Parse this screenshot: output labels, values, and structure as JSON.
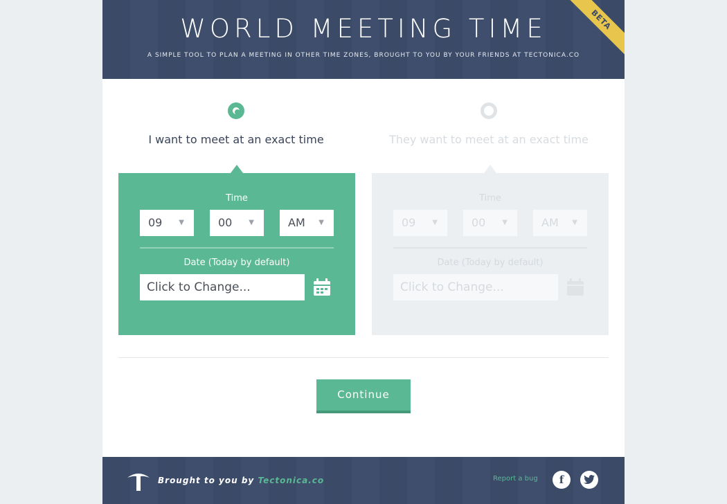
{
  "header": {
    "title": "WORLD MEETING TIME",
    "subtitle": "A SIMPLE TOOL TO PLAN A MEETING IN OTHER TIME ZONES, BROUGHT TO YOU BY YOUR FRIENDS AT TECTONICA.CO",
    "beta_label": "BETA"
  },
  "options": [
    {
      "label": "I want to meet at an exact time",
      "selected": true
    },
    {
      "label": "They want to meet at an exact time",
      "selected": false
    }
  ],
  "panel": {
    "time_label": "Time",
    "hour": "09",
    "minute": "00",
    "ampm": "AM",
    "date_label": "Date (Today by default)",
    "date_placeholder": "Click to Change..."
  },
  "continue_label": "Continue",
  "footer": {
    "brought_prefix": "Brought to you by",
    "brought_link": "Tectonica.co",
    "report_bug": "Report a bug",
    "facebook_glyph": "f",
    "twitter_glyph": "t"
  },
  "colors": {
    "accent": "#5bb894",
    "header_bg": "#3b4a67",
    "beta": "#e8c54d"
  }
}
